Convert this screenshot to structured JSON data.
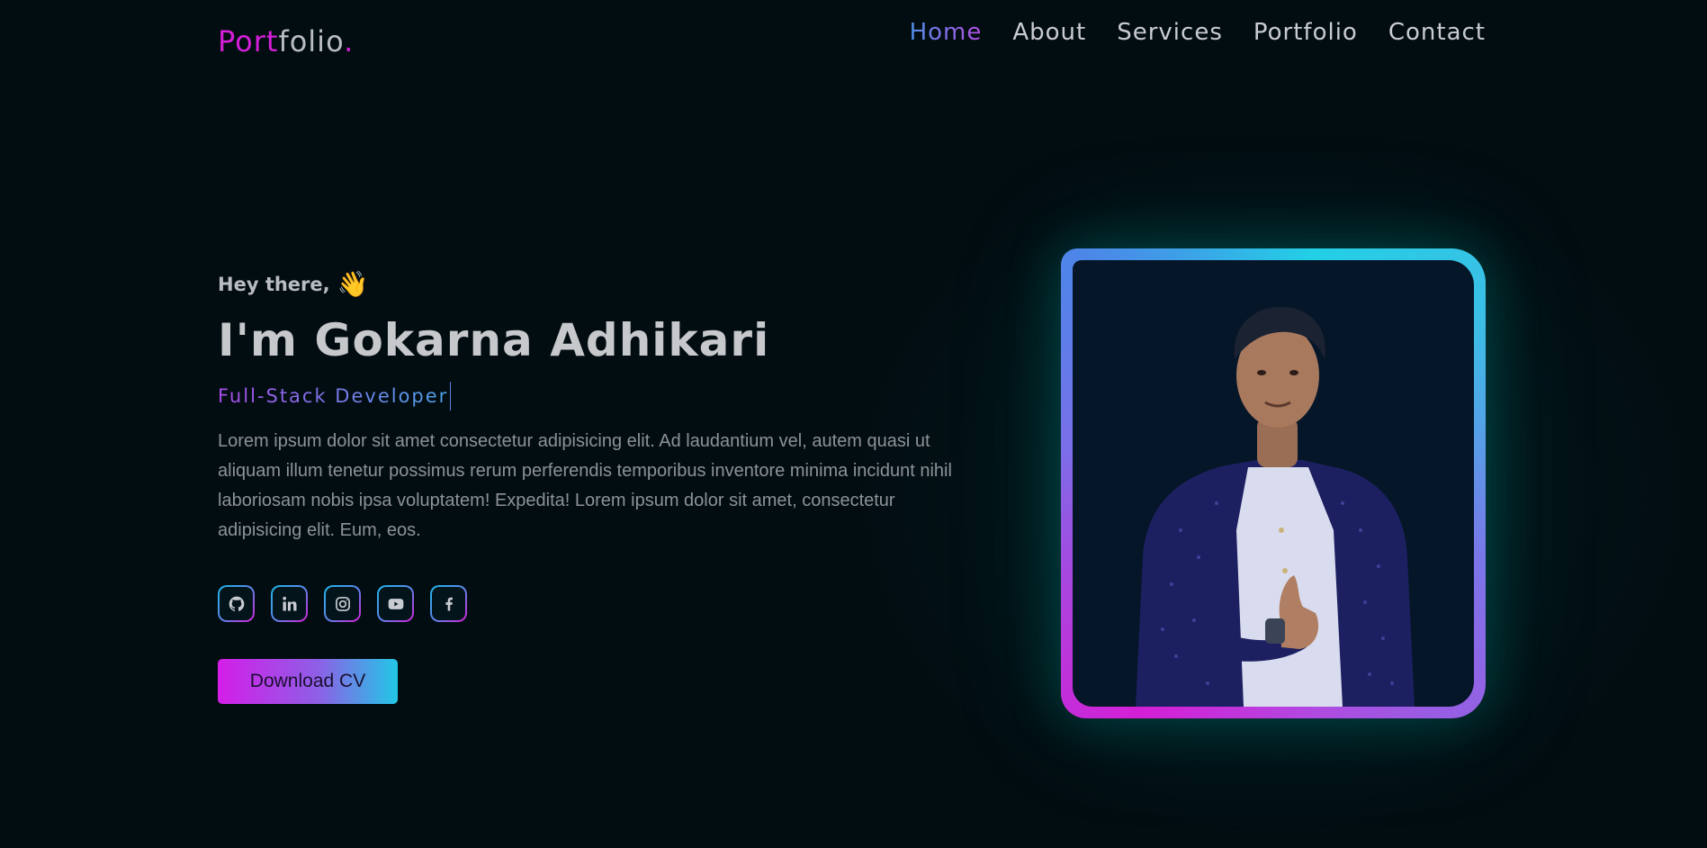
{
  "header": {
    "logo_part1": "Port",
    "logo_part2": "folio",
    "logo_part3": ".",
    "nav": [
      {
        "label": "Home",
        "active": true
      },
      {
        "label": "About",
        "active": false
      },
      {
        "label": "Services",
        "active": false
      },
      {
        "label": "Portfolio",
        "active": false
      },
      {
        "label": "Contact",
        "active": false
      }
    ]
  },
  "hero": {
    "greeting": "Hey there,",
    "greeting_emoji": "👋",
    "name": "I'm Gokarna Adhikari",
    "role": "Full-Stack Developer",
    "description": "Lorem ipsum dolor sit amet consectetur adipisicing elit. Ad laudantium vel, autem quasi ut aliquam illum tenetur possimus rerum perferendis temporibus inventore minima incidunt nihil laboriosam nobis ipsa voluptatem! Expedita! Lorem ipsum dolor sit amet, consectetur adipisicing elit. Eum, eos.",
    "cv_button": "Download CV",
    "socials": [
      "github-icon",
      "linkedin-icon",
      "instagram-icon",
      "youtube-icon",
      "facebook-icon"
    ]
  },
  "colors": {
    "accent_pink": "#d41fd6",
    "accent_cyan": "#22c7e6",
    "background": "#020d12"
  }
}
